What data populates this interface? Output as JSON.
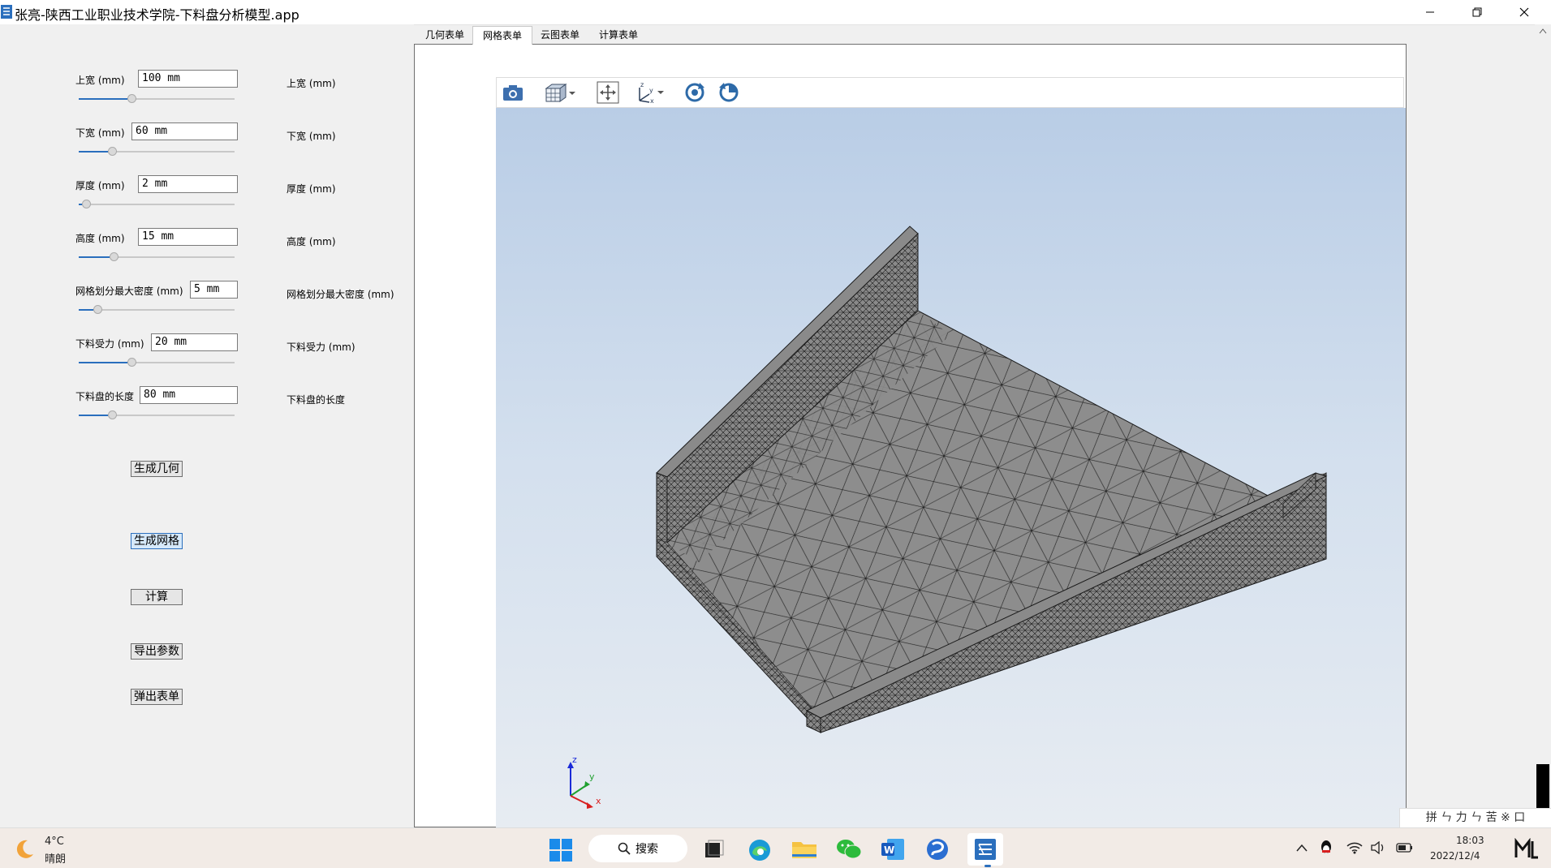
{
  "window": {
    "title": "张亮-陕西工业职业技术学院-下料盘分析模型.app"
  },
  "params": [
    {
      "label": "上宽 (mm)",
      "value": "100 mm",
      "slider": 0.33,
      "out_label": "上宽 (mm)"
    },
    {
      "label": "下宽 (mm)",
      "value": "60 mm",
      "slider": 0.2,
      "out_label": "下宽 (mm)"
    },
    {
      "label": "厚度 (mm)",
      "value": "2 mm",
      "slider": 0.02,
      "out_label": "厚度 (mm)"
    },
    {
      "label": "高度 (mm)",
      "value": "15 mm",
      "slider": 0.21,
      "out_label": "高度 (mm)"
    },
    {
      "label": "网格划分最大密度 (mm)",
      "value": "5 mm",
      "slider": 0.1,
      "out_label": "网格划分最大密度 (mm)"
    },
    {
      "label": "下料受力 (mm)",
      "value": "20 mm",
      "slider": 0.33,
      "out_label": "下料受力 (mm)"
    },
    {
      "label": "下料盘的长度",
      "value": "80 mm",
      "slider": 0.2,
      "out_label": "下料盘的长度"
    }
  ],
  "buttons": {
    "generate_geometry": "生成几何",
    "generate_mesh": "生成网格",
    "compute": "计算",
    "export_params": "导出参数",
    "popup_form": "弹出表单"
  },
  "tabs": [
    "几何表单",
    "网格表单",
    "云图表单",
    "计算表单"
  ],
  "active_tab": 1,
  "viewer": {
    "toolbar_icons": [
      "camera-icon",
      "view-cube-icon",
      "zoom-extents-icon",
      "axis-orientation-icon",
      "rotate-cw-icon",
      "rotate-ccw-icon"
    ],
    "axes": {
      "z": "z",
      "y": "y",
      "x": "x"
    }
  },
  "taskbar": {
    "weather_temp": "4°C",
    "weather_desc": "晴朗",
    "search_label": "搜索",
    "time": "18:03",
    "date": "2022/12/4",
    "ime_text": "拼 ㄣ 力 ㄣ 苦 ※ 口"
  },
  "colors": {
    "accent": "#2b6fbd",
    "mesh_fill": "#8a8a8a",
    "mesh_line": "#1a1a1a",
    "viewport_top": "#b9cde6",
    "viewport_bottom": "#e7ecf2"
  }
}
